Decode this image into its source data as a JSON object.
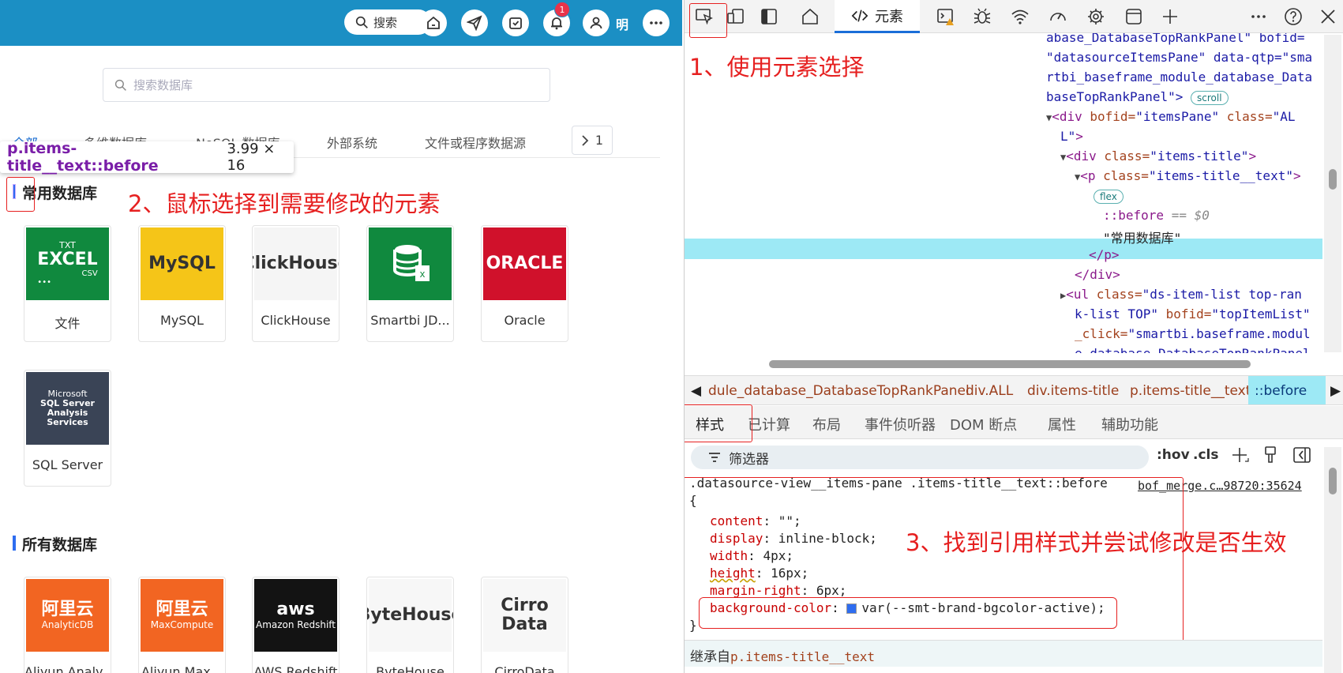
{
  "app": {
    "search_label": "搜索",
    "notification_count": "1",
    "user_name": "明",
    "db_search_placeholder": "搜索数据库",
    "tabs": [
      "全部",
      "多维数据库",
      "NoSQL 数据库",
      "外部系统",
      "文件或程序数据源"
    ],
    "tab_page": "1",
    "section_common": "常用数据库",
    "section_all": "所有数据库",
    "common_dbs": [
      {
        "label": "文件",
        "logo_text": "EXCEL",
        "logo_sub_top": "TXT",
        "logo_sub_bottom": "CSV",
        "logo_dots": "•••",
        "color": "#10893e"
      },
      {
        "label": "MySQL",
        "logo_text": "MySQL",
        "color": "#f5c518"
      },
      {
        "label": "ClickHouse",
        "logo_text": "ClickHouse",
        "color": "#f5f5f5"
      },
      {
        "label": "Smartbi JD...",
        "logo_text": "",
        "color": "#10893e"
      },
      {
        "label": "Oracle",
        "logo_text": "ORACLE",
        "color": "#d0112b"
      },
      {
        "label": "SQL Server",
        "logo_text": "SQL Server Analysis Services",
        "logo_sub_top": "Microsoft",
        "color": "#3a4456"
      }
    ],
    "all_dbs": [
      {
        "label": "Aliyun Analy...",
        "logo_text": "阿里云",
        "logo_sub": "AnalyticDB",
        "color": "#f26522"
      },
      {
        "label": "Aliyun Max...",
        "logo_text": "阿里云",
        "logo_sub": "MaxCompute",
        "color": "#f26522"
      },
      {
        "label": "AWS Redshift",
        "logo_text": "aws",
        "logo_sub": "Amazon Redshift",
        "color": "#131313"
      },
      {
        "label": "ByteHouse",
        "logo_text": "ByteHouse",
        "color": "#f7f7f7"
      },
      {
        "label": "CirroData",
        "logo_text": "Cirro Data",
        "color": "#f7f7f7"
      }
    ],
    "tooltip": {
      "selector": "p.items-title__text::before",
      "size": "3.99 × 16"
    }
  },
  "annotations": {
    "step1": "1、使用元素选择",
    "step2": "2、鼠标选择到需要修改的元素",
    "step3": "3、找到引用样式并尝试修改是否生效"
  },
  "devtools": {
    "elements_tab": "元素",
    "tree": {
      "l1": "abase_DatabaseTopRankPanel\" bofid=",
      "l2": "\"datasourceItemsPane\" data-qtp=\"sma",
      "l3": "rtbi_baseframe_module_database_Data",
      "l4": "baseTopRankPanel\">",
      "scroll_pill": "scroll",
      "l5_tag": "<div",
      "l5_attr1": " bofid=",
      "l5_val1": "\"itemsPane\"",
      "l5_attr2": " class=",
      "l5_val2": "\"AL",
      "l6_val": "L\"",
      "l6_tag": ">",
      "l7_tag": "<div",
      "l7_attr": " class=",
      "l7_val": "\"items-title\"",
      "l7_end": ">",
      "l8_tag": "<p",
      "l8_attr": " class=",
      "l8_val": "\"items-title__text\"",
      "l8_end": ">",
      "flex_pill": "flex",
      "before": "::before",
      "before_eq": "== $0",
      "text_node": "\"常用数据库\"",
      "close_p": "</p>",
      "close_div": "</div>",
      "ul_tag": "<ul",
      "ul_attr": " class=",
      "ul_val": "\"ds-item-list top-ran",
      "ul_l2_val": "k-list TOP\"",
      "ul_l2_attr": " bofid=",
      "ul_l2_val2": "\"topItemList\"",
      "ul_l3_attr": "_click=",
      "ul_l3_val": "\"smartbi.baseframe.modul",
      "ul_l4": "e_database_DatabaseTopRankPanel"
    },
    "breadcrumbs": [
      "dule_database_DatabaseTopRankPanel",
      "div.ALL",
      "div.items-title",
      "p.items-title__text",
      "::before"
    ],
    "subtabs": [
      "样式",
      "已计算",
      "布局",
      "事件侦听器",
      "DOM 断点",
      "属性",
      "辅助功能"
    ],
    "filter_placeholder": "筛选器",
    "hov": ":hov",
    "cls": ".cls",
    "rule_selector": ".datasource-view__items-pane .items-title__text::before",
    "rule_open": "{",
    "rule_source": "bof_merge.c…98720:35624",
    "rule_props": [
      {
        "name": "content",
        "value": "\"\";"
      },
      {
        "name": "display",
        "value": "inline-block;"
      },
      {
        "name": "width",
        "value": "4px;"
      },
      {
        "name": "height",
        "value": "16px;"
      },
      {
        "name": "margin-right",
        "value": "6px;"
      },
      {
        "name": "background-color",
        "value": "var(--smt-brand-bgcolor-active);"
      }
    ],
    "rule_close": "}",
    "inherit_label": "继承自",
    "inherit_selector": "p.items-title__text",
    "swatch_color": "#2e6df0"
  }
}
